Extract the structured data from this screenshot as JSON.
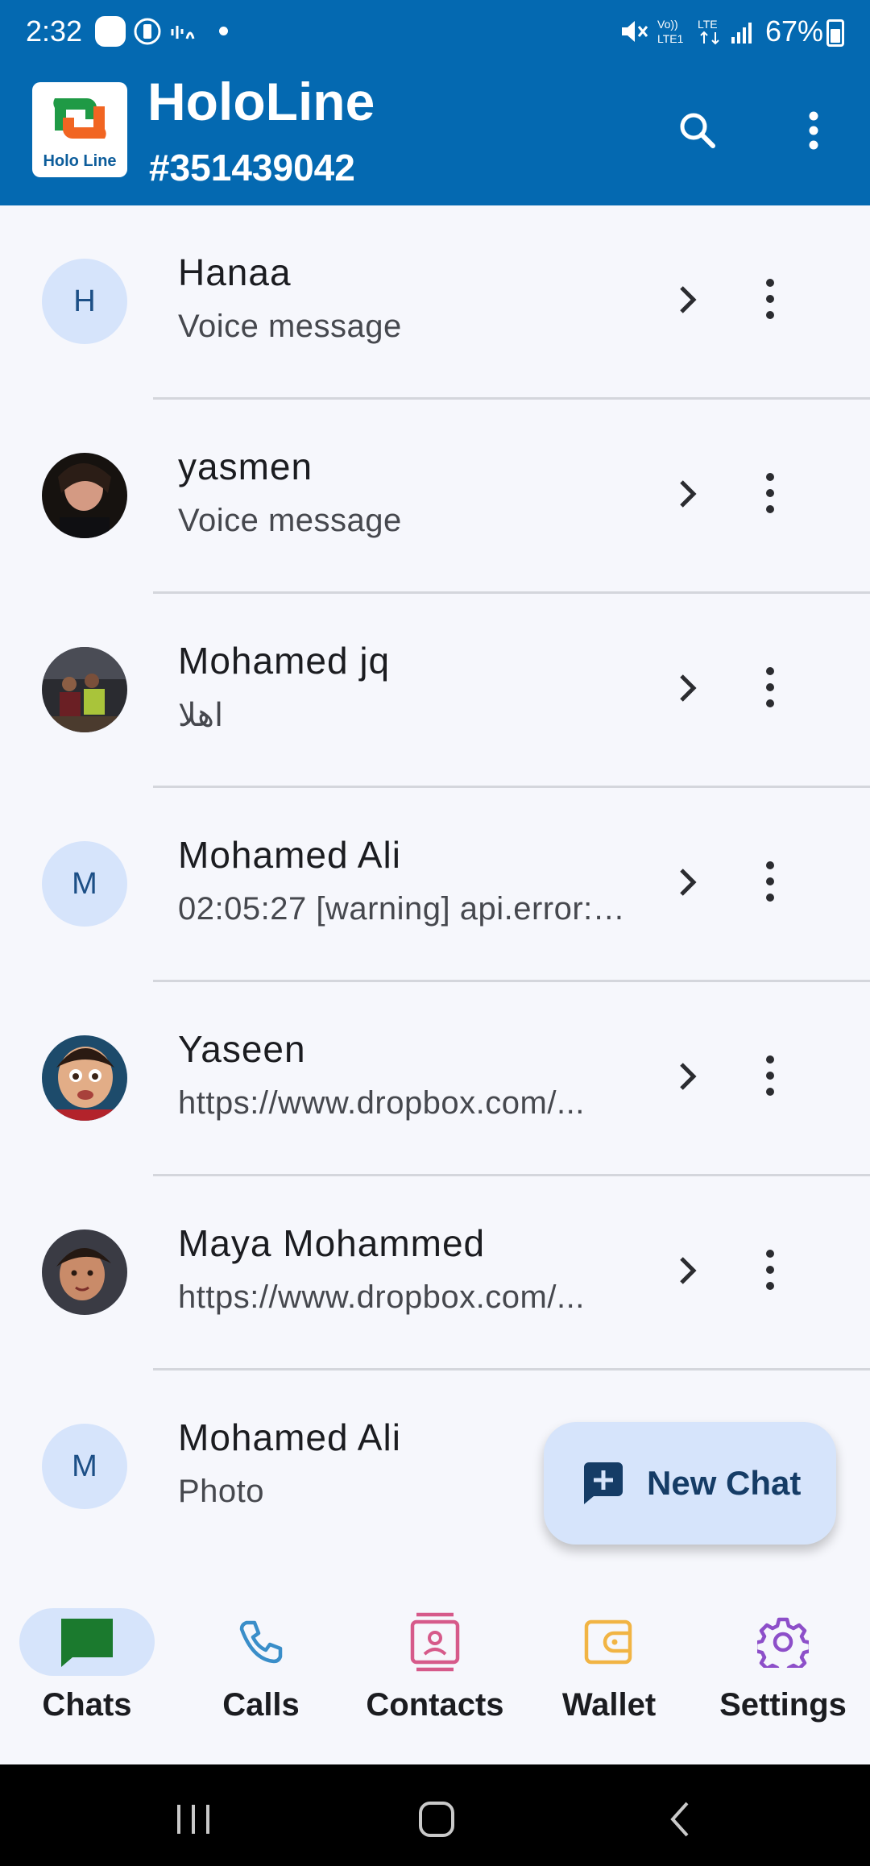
{
  "status_bar": {
    "time": "2:32",
    "battery": "67%"
  },
  "header": {
    "app_name": "HoloLine",
    "logo_text": "Holo Line",
    "account_id": "#351439042",
    "colors": {
      "primary": "#0469b1"
    }
  },
  "chats": [
    {
      "name": "Hanaa",
      "preview": "Voice message",
      "avatar_initial": "H",
      "avatar_type": "initial"
    },
    {
      "name": "yasmen",
      "preview": "Voice message",
      "avatar_initial": "",
      "avatar_type": "photo"
    },
    {
      "name": "Mohamed jq",
      "preview": "اهلا",
      "avatar_initial": "",
      "avatar_type": "photo"
    },
    {
      "name": "Mohamed Ali",
      "preview": "02:05:27 [warning] api.error: ...",
      "avatar_initial": "M",
      "avatar_type": "initial"
    },
    {
      "name": "Yaseen",
      "preview": "https://www.dropbox.com/...",
      "avatar_initial": "",
      "avatar_type": "photo"
    },
    {
      "name": "Maya Mohammed",
      "preview": "https://www.dropbox.com/...",
      "avatar_initial": "",
      "avatar_type": "photo"
    },
    {
      "name": "Mohamed Ali",
      "preview": "Photo",
      "avatar_initial": "M",
      "avatar_type": "initial"
    }
  ],
  "fab": {
    "label": "New Chat"
  },
  "nav": [
    {
      "label": "Chats",
      "icon": "chat-bubble-icon",
      "color": "#1b7a2e",
      "active": true
    },
    {
      "label": "Calls",
      "icon": "phone-icon",
      "color": "#3a8ec9",
      "active": false
    },
    {
      "label": "Contacts",
      "icon": "contact-card-icon",
      "color": "#d65a8a",
      "active": false
    },
    {
      "label": "Wallet",
      "icon": "wallet-icon",
      "color": "#f1b444",
      "active": false
    },
    {
      "label": "Settings",
      "icon": "gear-icon",
      "color": "#8d4fc9",
      "active": false
    }
  ]
}
